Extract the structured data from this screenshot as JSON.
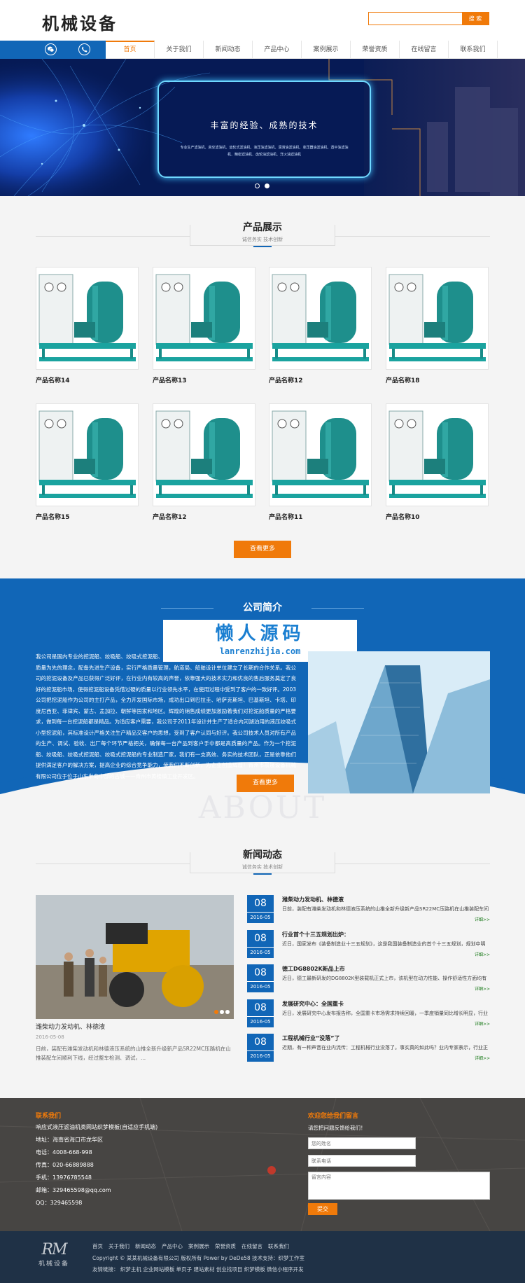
{
  "header": {
    "logo_text": "机械设备",
    "search_placeholder": "",
    "search_button": "搜 索"
  },
  "nav": {
    "icons": [
      "wechat-icon",
      "phone-icon"
    ],
    "items": [
      "首页",
      "关于我们",
      "新闻动态",
      "产品中心",
      "案例展示",
      "荣誉资质",
      "在线留言",
      "联系我们"
    ],
    "active_index": 0
  },
  "banner": {
    "title": "丰富的经验、成熟的技术",
    "desc": "专业生产滤油机、真空滤油机、齿轮式滤油机、液压油滤油机、润滑油滤油机、变压器油滤油机、透平油滤油机、精密滤油机、齿轮油滤油机、洋火油滤油机",
    "slides": 2,
    "active_slide": 1
  },
  "products": {
    "title": "产品展示",
    "subtitle": "诚信务实 技术创新",
    "items": [
      "产品名称14",
      "产品名称13",
      "产品名称12",
      "产品名称18",
      "产品名称15",
      "产品名称12",
      "产品名称11",
      "产品名称10"
    ],
    "more_button": "查看更多"
  },
  "about": {
    "title": "公司简介",
    "watermark_cn": "懒人源码",
    "watermark_en": "lanrenzhijia.com",
    "text": "我公司是国内专业的挖泥船、绞吸船、绞吸式挖泥船、绞吸式挖泥船厂家，自成立以来公司一直秉承诚信经营、质量为先的理念，配备先进生产设备，实行严格质量管理，航道局、船舶设计单位建立了长期的合作关系。我公司的挖泥设备及产品已获得广泛好评，在行业内有较高的声誉，依靠强大的技术实力和优良的售后服务奠定了良好的挖泥船市场，使得挖泥船设备凭借过硬的质量以行业领先水平，在使用过程中受到了客户的一致好评。2003公司把挖泥船作为公司的主打产品，全力开发国际市场，成功出口到巴拉圭、哈萨克斯坦、巴基斯坦、卡塔、印度尼西亚、菲律宾、蒙古、孟加拉、朝鲜等国家和地区。辉煌的销售成绩更加激励着我们对挖泥船质量的严格要求，做到每一台挖泥船都是精品。为适应客户需要，我公司于2011年设计并生产了适合内河湖泊用的液压绞吸式小型挖泥船，其标准设计严格关注生产精品交客户的思想，受到了客户认同与好评。我公司技术人员对所有产品的生产、调试、验收、出厂每个环节严格把关，确保每一台产品到客户手中都是高质量的产品。作为一个挖泥船、绞吸船、绞吸式挖泥船、绞吸式挖泥船的专业制造厂家，我们有一支高效、务实的技术团队，正是依靠他们提供满足客户的解决方案，提高企业的综合竞争能力，使我们不断创新，为企业创造辉煌！青州市晨晟设备机械有限公司位于位于山东半岛中部的古城——青州市黄楼镇工业开发区。",
    "more_button": "查看更多",
    "bg_word": "ABOUT"
  },
  "news": {
    "title": "新闻动态",
    "subtitle": "诚信务实 技术创新",
    "main": {
      "title": "潍柴动力发动机、林德液",
      "date": "2016-05-08",
      "desc": "日前，装配有潍柴发动机和林德液压系统的山推全新升级新产品SR22MC压路机在山推装配车间顺利下线，经过整车检测、调试，..."
    },
    "items": [
      {
        "day": "08",
        "ym": "2016-05",
        "title": "潍柴动力发动机、林德液",
        "desc": "日前，装配有潍柴发动机和林德液压系统的山推全新升级新产品SR22MC压路机在山推装配车间顺利下线，经过整车检测、调试，...",
        "more": "详细>>"
      },
      {
        "day": "08",
        "ym": "2016-05",
        "title": "行业首个十三五规划出炉：",
        "desc": "近日，国家发布《装备制造业十三五规划》，这是我国装备制造业的首个十三五规划，规划中明确了未来五年行业发展的重点方向。...",
        "more": "详细>>"
      },
      {
        "day": "08",
        "ym": "2016-05",
        "title": "德工DG8802K新品上市",
        "desc": "近日，德工最新研发的DG8802K型装载机正式上市，该机型在动力性能、操作舒适性方面均有较大提升，受到用户广泛关注。...",
        "more": "详细>>"
      },
      {
        "day": "08",
        "ym": "2016-05",
        "title": "发展研究中心：全国重卡",
        "desc": "近日，发展研究中心发布报告称，全国重卡市场需求持续回暖，一季度销量同比增长明显，行业整体呈现稳中向好态势。...",
        "more": "详细>>"
      },
      {
        "day": "08",
        "ym": "2016-05",
        "title": "工程机械行业“没落”了",
        "desc": "近期，有一种声音在业内流传：工程机械行业没落了。事实真的如此吗？业内专家表示，行业正处于调整期，长期发展前景依然向好。...",
        "more": "详细>>"
      }
    ]
  },
  "contact": {
    "title": "联系我们",
    "lines": [
      "响应式液压滤油机类网站织梦模板(自适应手机端)",
      "地址：海南省海口市龙华区",
      "电话：4008-668-998",
      "传真：020-66889888",
      "手机：13976785548",
      "邮箱：329465598@qq.com",
      "QQ：329465598"
    ],
    "form_title": "欢迎您给我们留言",
    "form_hint": "请您把问题反馈给我们！",
    "name_placeholder": "您的姓名",
    "phone_placeholder": "联系电话",
    "message_placeholder": "留言内容",
    "submit": "提交"
  },
  "footer": {
    "logo_big": "RM",
    "logo_small": "机械设备",
    "links": [
      "首页",
      "关于我们",
      "新闻动态",
      "产品中心",
      "案例展示",
      "荣誉资质",
      "在线留言",
      "联系我们"
    ],
    "copyright": "Copyright © 某某机械设备有限公司 版权所有 Power by DeDe58 技术支持：织梦工作室",
    "friend_links": "友情链接：  织梦主机  企业网站模板  单页子  建站素材  创业找项目  织梦模板  微信小程序开发"
  },
  "colors": {
    "brand_blue": "#1166b7",
    "accent_orange": "#f07a0a",
    "footer_dark": "#1f3146"
  }
}
